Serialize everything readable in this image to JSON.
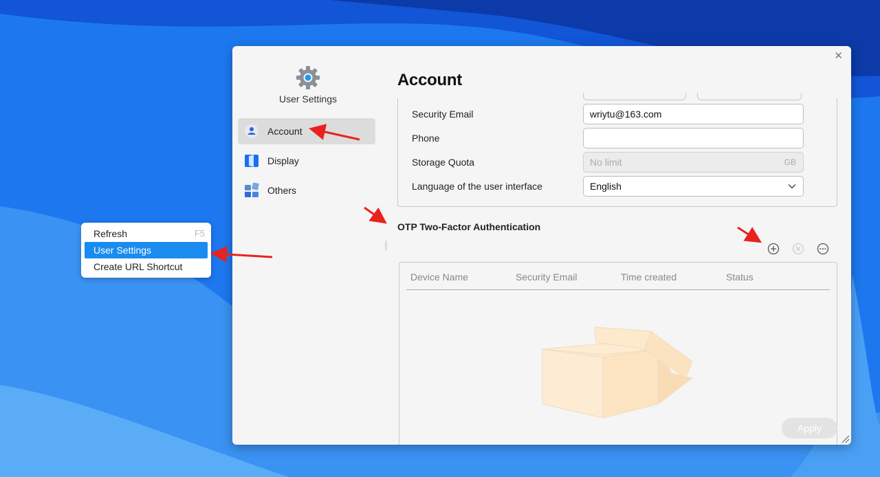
{
  "context_menu": {
    "items": [
      {
        "label": "Refresh",
        "shortcut": "F5"
      },
      {
        "label": "User Settings"
      },
      {
        "label": "Create URL Shortcut"
      }
    ]
  },
  "sidebar": {
    "title": "User Settings",
    "logo_icon": "gear-icon",
    "items": [
      {
        "label": "Account",
        "icon": "user-icon",
        "active": true
      },
      {
        "label": "Display",
        "icon": "display-icon"
      },
      {
        "label": "Others",
        "icon": "others-icon"
      }
    ]
  },
  "window": {
    "close_icon": "close-icon"
  },
  "main": {
    "title": "Account",
    "form": {
      "security_email": {
        "label": "Security Email",
        "value": "wriytu@163.com"
      },
      "phone": {
        "label": "Phone",
        "value": ""
      },
      "storage_quota": {
        "label": "Storage Quota",
        "placeholder": "No limit",
        "unit": "GB"
      },
      "language": {
        "label": "Language of the user interface",
        "value": "English"
      }
    },
    "otp": {
      "title": "OTP Two-Factor Authentication",
      "toolbar_icons": [
        "add-icon",
        "delete-icon",
        "more-icon"
      ],
      "columns": [
        "Device Name",
        "Security Email",
        "Time created",
        "Status"
      ]
    },
    "apply_label": "Apply"
  },
  "colors": {
    "accent": "#1a8cf0",
    "annotation_arrow": "#e8231e",
    "window_bg": "#f5f5f5"
  }
}
